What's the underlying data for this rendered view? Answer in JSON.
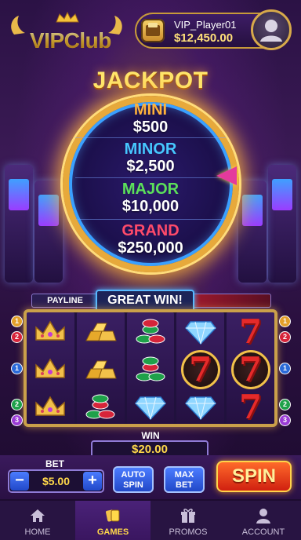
{
  "header": {
    "logo_text": "VIPClub",
    "player_name": "VIP_Player01",
    "balance": "$12,450.00"
  },
  "jackpot": {
    "title": "JACKPOT",
    "tiers": [
      {
        "name": "MINI",
        "value": "$500",
        "color": "#ffb13a"
      },
      {
        "name": "MINOR",
        "value": "$2,500",
        "color": "#46c8ff"
      },
      {
        "name": "MAJOR",
        "value": "$10,000",
        "color": "#5be05a"
      },
      {
        "name": "GRAND",
        "value": "$250,000",
        "color": "#ff4a6a"
      }
    ]
  },
  "banner": {
    "payline_label": "PAYLINE",
    "message": "GREAT WIN!"
  },
  "reels": [
    [
      "crown",
      "crown",
      "crown"
    ],
    [
      "gold",
      "gold",
      "chips"
    ],
    [
      "chips",
      "chips",
      "diamond"
    ],
    [
      "diamond",
      "seven",
      "diamond"
    ],
    [
      "seven",
      "seven",
      "seven"
    ]
  ],
  "paylines_left": [
    "1",
    "2",
    "1",
    "2",
    "3"
  ],
  "paylines_right": [
    "1",
    "2",
    "1",
    "2",
    "3"
  ],
  "win": {
    "label": "WIN",
    "amount": "$20.00"
  },
  "controls": {
    "bet_label": "BET",
    "bet_value": "$5.00",
    "minus": "−",
    "plus": "+",
    "auto_spin": "AUTO SPIN",
    "max_bet": "MAX BET",
    "spin": "SPIN"
  },
  "nav": [
    {
      "label": "HOME",
      "icon": "home-icon"
    },
    {
      "label": "GAMES",
      "icon": "cards-icon"
    },
    {
      "label": "PROMOS",
      "icon": "gift-icon"
    },
    {
      "label": "ACCOUNT",
      "icon": "user-icon"
    }
  ]
}
